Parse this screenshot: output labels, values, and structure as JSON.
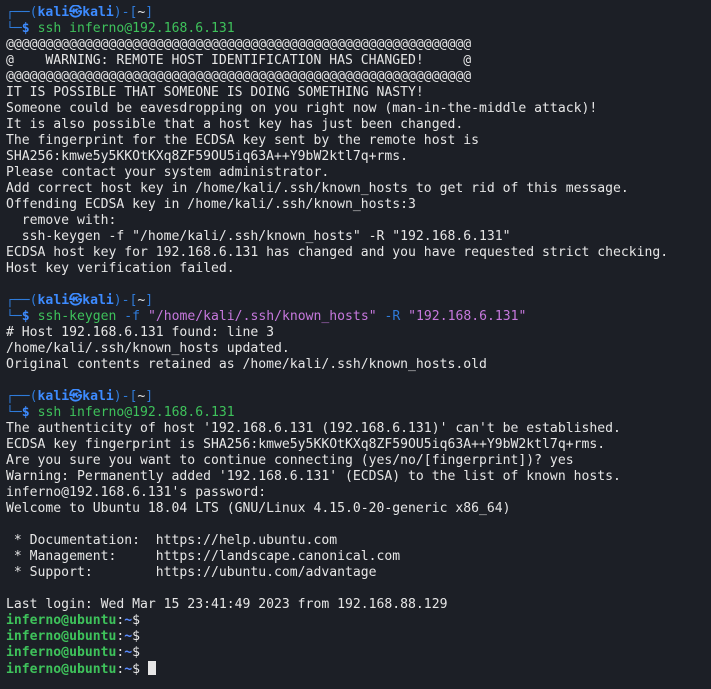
{
  "prompt": {
    "user": "kali",
    "at": "㉿",
    "host": "kali",
    "cwd": "~",
    "dollar": "$"
  },
  "block1": {
    "command": "ssh inferno@192.168.6.131",
    "output": [
      "@@@@@@@@@@@@@@@@@@@@@@@@@@@@@@@@@@@@@@@@@@@@@@@@@@@@@@@@@@@",
      "@    WARNING: REMOTE HOST IDENTIFICATION HAS CHANGED!     @",
      "@@@@@@@@@@@@@@@@@@@@@@@@@@@@@@@@@@@@@@@@@@@@@@@@@@@@@@@@@@@",
      "IT IS POSSIBLE THAT SOMEONE IS DOING SOMETHING NASTY!",
      "Someone could be eavesdropping on you right now (man-in-the-middle attack)!",
      "It is also possible that a host key has just been changed.",
      "The fingerprint for the ECDSA key sent by the remote host is",
      "SHA256:kmwe5y5KKOtKXq8ZF59OU5iq63A++Y9bW2ktl7q+rms.",
      "Please contact your system administrator.",
      "Add correct host key in /home/kali/.ssh/known_hosts to get rid of this message.",
      "Offending ECDSA key in /home/kali/.ssh/known_hosts:3",
      "  remove with:",
      "  ssh-keygen -f \"/home/kali/.ssh/known_hosts\" -R \"192.168.6.131\"",
      "ECDSA host key for 192.168.6.131 has changed and you have requested strict checking.",
      "Host key verification failed."
    ]
  },
  "block2": {
    "cmd": "ssh-keygen",
    "flag1": "-f",
    "arg1": "\"/home/kali/.ssh/known_hosts\"",
    "flag2": "-R",
    "arg2": "\"192.168.6.131\"",
    "output": [
      "# Host 192.168.6.131 found: line 3",
      "/home/kali/.ssh/known_hosts updated.",
      "Original contents retained as /home/kali/.ssh/known_hosts.old"
    ]
  },
  "block3": {
    "command": "ssh inferno@192.168.6.131",
    "output": [
      "The authenticity of host '192.168.6.131 (192.168.6.131)' can't be established.",
      "ECDSA key fingerprint is SHA256:kmwe5y5KKOtKXq8ZF59OU5iq63A++Y9bW2ktl7q+rms.",
      "Are you sure you want to continue connecting (yes/no/[fingerprint])? yes",
      "Warning: Permanently added '192.168.6.131' (ECDSA) to the list of known hosts.",
      "inferno@192.168.6.131's password:",
      "Welcome to Ubuntu 18.04 LTS (GNU/Linux 4.15.0-20-generic x86_64)",
      "",
      " * Documentation:  https://help.ubuntu.com",
      " * Management:     https://landscape.canonical.com",
      " * Support:        https://ubuntu.com/advantage",
      "",
      "Last login: Wed Mar 15 23:41:49 2023 from 192.168.88.129"
    ]
  },
  "remote_prompt": {
    "userhost": "inferno@ubuntu",
    "colon": ":",
    "path": "~",
    "dollar": "$"
  }
}
